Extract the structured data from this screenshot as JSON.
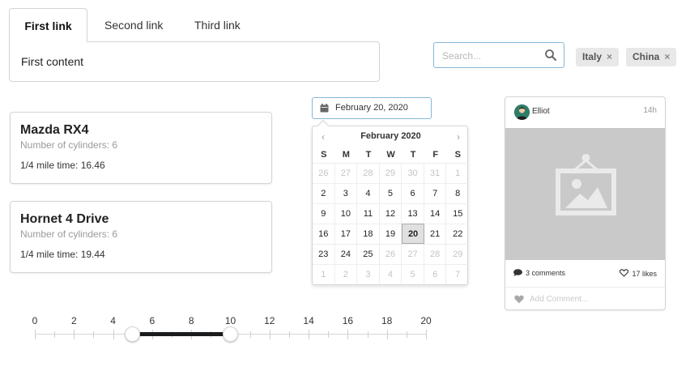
{
  "tabs": {
    "items": [
      {
        "label": "First link",
        "active": true
      },
      {
        "label": "Second link",
        "active": false
      },
      {
        "label": "Third link",
        "active": false
      }
    ],
    "content": "First content"
  },
  "search": {
    "placeholder": "Search...",
    "value": "",
    "icon": "search-icon"
  },
  "chips": [
    {
      "label": "Italy",
      "remove": "×"
    },
    {
      "label": "China",
      "remove": "×"
    }
  ],
  "cars": [
    {
      "name": "Mazda RX4",
      "cylinders": "Number of cylinders: 6",
      "quarter_mile": "1/4 mile time: 16.46"
    },
    {
      "name": "Hornet 4 Drive",
      "cylinders": "Number of cylinders: 6",
      "quarter_mile": "1/4 mile time: 19.44"
    }
  ],
  "datepicker": {
    "value": "February 20, 2020",
    "month_label": "February 2020",
    "prev": "‹",
    "next": "›",
    "weekdays": [
      "S",
      "M",
      "T",
      "W",
      "T",
      "F",
      "S"
    ],
    "days": [
      {
        "d": "26",
        "muted": true
      },
      {
        "d": "27",
        "muted": true
      },
      {
        "d": "28",
        "muted": true
      },
      {
        "d": "29",
        "muted": true
      },
      {
        "d": "30",
        "muted": true
      },
      {
        "d": "31",
        "muted": true
      },
      {
        "d": "1",
        "muted": true
      },
      {
        "d": "2"
      },
      {
        "d": "3"
      },
      {
        "d": "4"
      },
      {
        "d": "5"
      },
      {
        "d": "6"
      },
      {
        "d": "7"
      },
      {
        "d": "8"
      },
      {
        "d": "9"
      },
      {
        "d": "10"
      },
      {
        "d": "11"
      },
      {
        "d": "12"
      },
      {
        "d": "13"
      },
      {
        "d": "14"
      },
      {
        "d": "15"
      },
      {
        "d": "16"
      },
      {
        "d": "17"
      },
      {
        "d": "18"
      },
      {
        "d": "19"
      },
      {
        "d": "20",
        "selected": true
      },
      {
        "d": "21"
      },
      {
        "d": "22"
      },
      {
        "d": "23"
      },
      {
        "d": "24"
      },
      {
        "d": "25"
      },
      {
        "d": "26",
        "muted": true
      },
      {
        "d": "27",
        "muted": true
      },
      {
        "d": "28",
        "muted": true
      },
      {
        "d": "29",
        "muted": true
      },
      {
        "d": "1",
        "muted": true
      },
      {
        "d": "2",
        "muted": true
      },
      {
        "d": "3",
        "muted": true
      },
      {
        "d": "4",
        "muted": true
      },
      {
        "d": "5",
        "muted": true
      },
      {
        "d": "6",
        "muted": true
      },
      {
        "d": "7",
        "muted": true
      }
    ]
  },
  "post": {
    "author": "Elliot",
    "time": "14h",
    "comments": "3 comments",
    "likes": "17 likes",
    "add_comment_placeholder": "Add Comment..."
  },
  "slider": {
    "min": 0,
    "max": 20,
    "tick_labels": [
      "0",
      "2",
      "4",
      "6",
      "8",
      "10",
      "12",
      "14",
      "16",
      "18",
      "20"
    ],
    "range": [
      5,
      10
    ]
  },
  "colors": {
    "focus_border": "#85b7d9",
    "range_fill": "#1b1c1d",
    "chip_bg": "#e8e8e8"
  }
}
